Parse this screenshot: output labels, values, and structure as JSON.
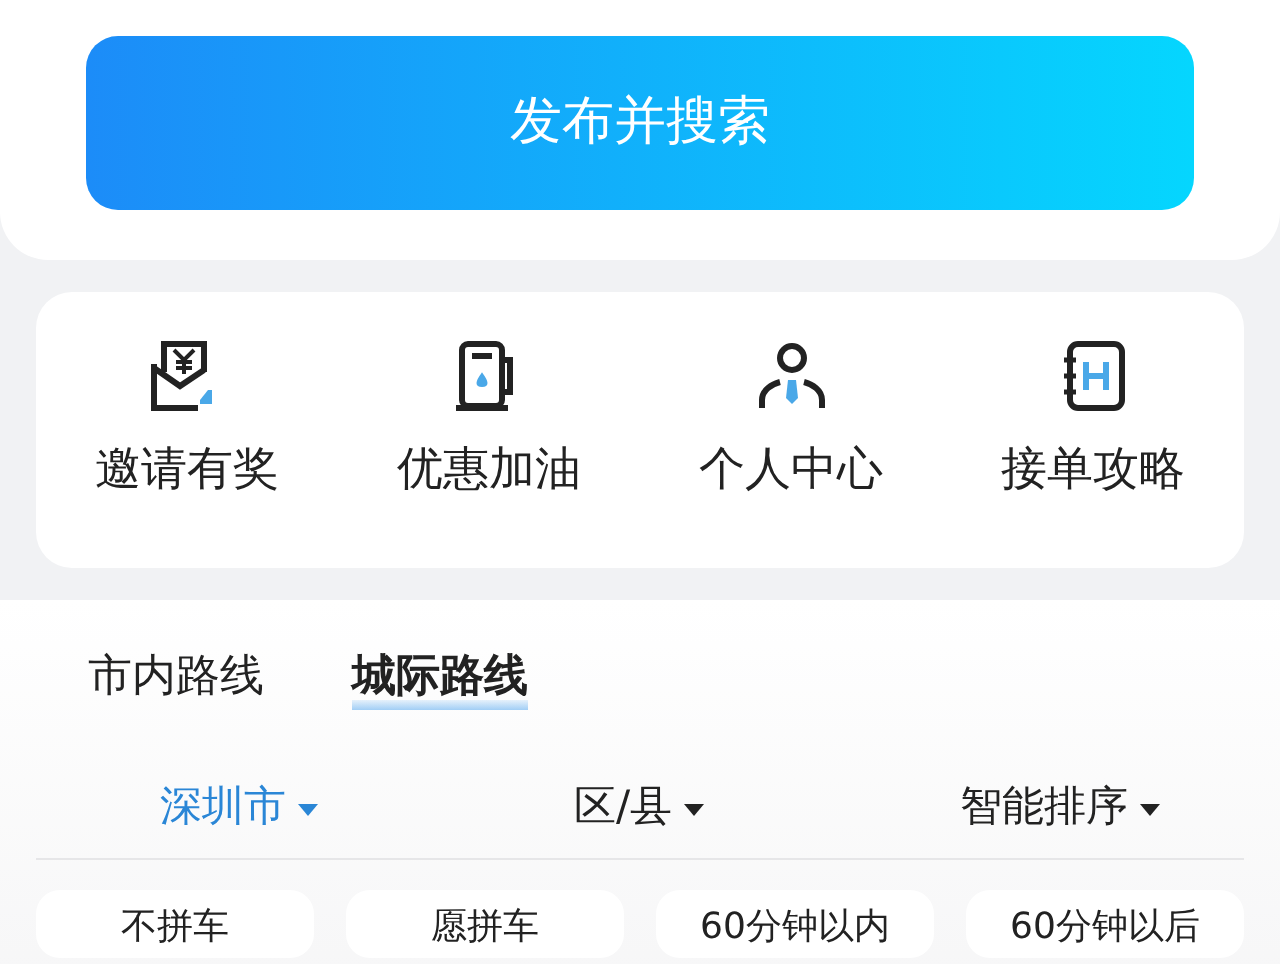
{
  "publish_button": "发布并搜索",
  "shortcuts": [
    {
      "kind": "invite",
      "label": "邀请有奖"
    },
    {
      "kind": "fuel",
      "label": "优惠加油"
    },
    {
      "kind": "person",
      "label": "个人中心"
    },
    {
      "kind": "guide",
      "label": "接单攻略"
    }
  ],
  "tabs": [
    {
      "label": "市内路线",
      "selected": false
    },
    {
      "label": "城际路线",
      "selected": true
    }
  ],
  "filters": [
    {
      "label": "深圳市",
      "selected": true
    },
    {
      "label": "区/县",
      "selected": false
    },
    {
      "label": "智能排序",
      "selected": false
    }
  ],
  "chips": [
    "不拼车",
    "愿拼车",
    "60分钟以内",
    "60分钟以后"
  ]
}
